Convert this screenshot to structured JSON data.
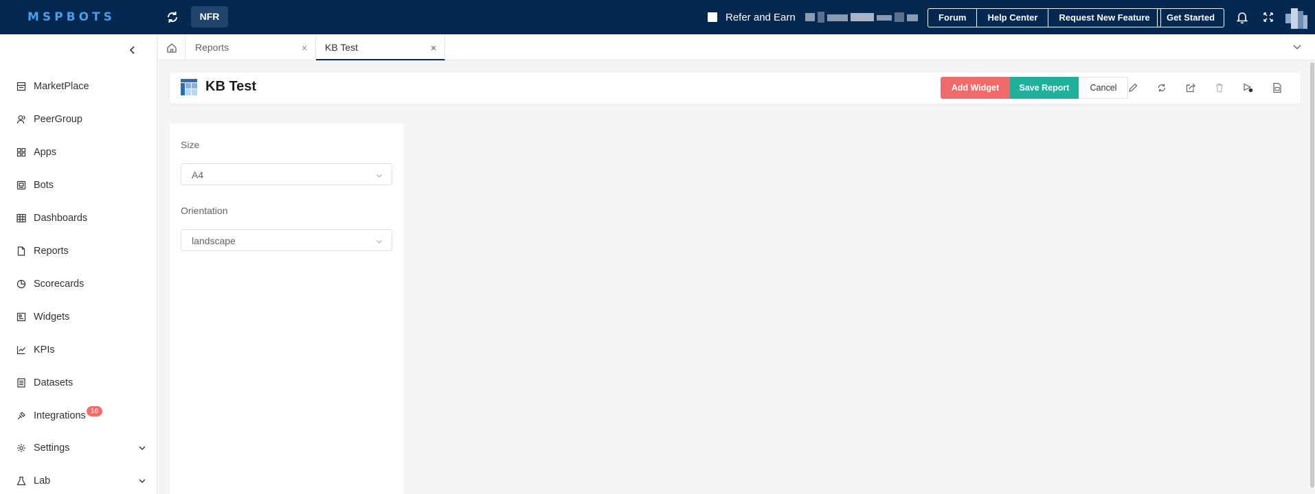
{
  "app": {
    "logo_text": "MSPBOTS",
    "env_label": "NFR",
    "refer_label": "Refer and Earn",
    "links": [
      "Forum",
      "Help Center",
      "Request New Feature"
    ],
    "get_started_label": "Get Started"
  },
  "sidebar": {
    "items": [
      {
        "label": "MarketPlace",
        "icon": "store-icon"
      },
      {
        "label": "PeerGroup",
        "icon": "people-icon"
      },
      {
        "label": "Apps",
        "icon": "apps-icon"
      },
      {
        "label": "Bots",
        "icon": "bot-icon"
      },
      {
        "label": "Dashboards",
        "icon": "dashboard-icon"
      },
      {
        "label": "Reports",
        "icon": "report-icon"
      },
      {
        "label": "Scorecards",
        "icon": "scorecard-icon"
      },
      {
        "label": "Widgets",
        "icon": "widget-icon"
      },
      {
        "label": "KPIs",
        "icon": "chart-icon"
      },
      {
        "label": "Datasets",
        "icon": "dataset-icon"
      },
      {
        "label": "Integrations",
        "icon": "integration-icon",
        "badge": "16"
      },
      {
        "label": "Settings",
        "icon": "gear-icon"
      },
      {
        "label": "Lab",
        "icon": "flask-icon"
      }
    ]
  },
  "tabs": [
    {
      "label": "Reports"
    },
    {
      "label": "KB Test"
    }
  ],
  "report": {
    "title": "KB Test",
    "add_widget_label": "Add Widget",
    "save_report_label": "Save Report",
    "cancel_label": "Cancel"
  },
  "settings": {
    "size_label": "Size",
    "size_value": "A4",
    "orientation_label": "Orientation",
    "orientation_value": "landscape"
  },
  "colors": {
    "topbar": "#04284f",
    "add_widget": "#ef6a6a",
    "save_report": "#1fb19c",
    "badge": "#f56c6c"
  }
}
